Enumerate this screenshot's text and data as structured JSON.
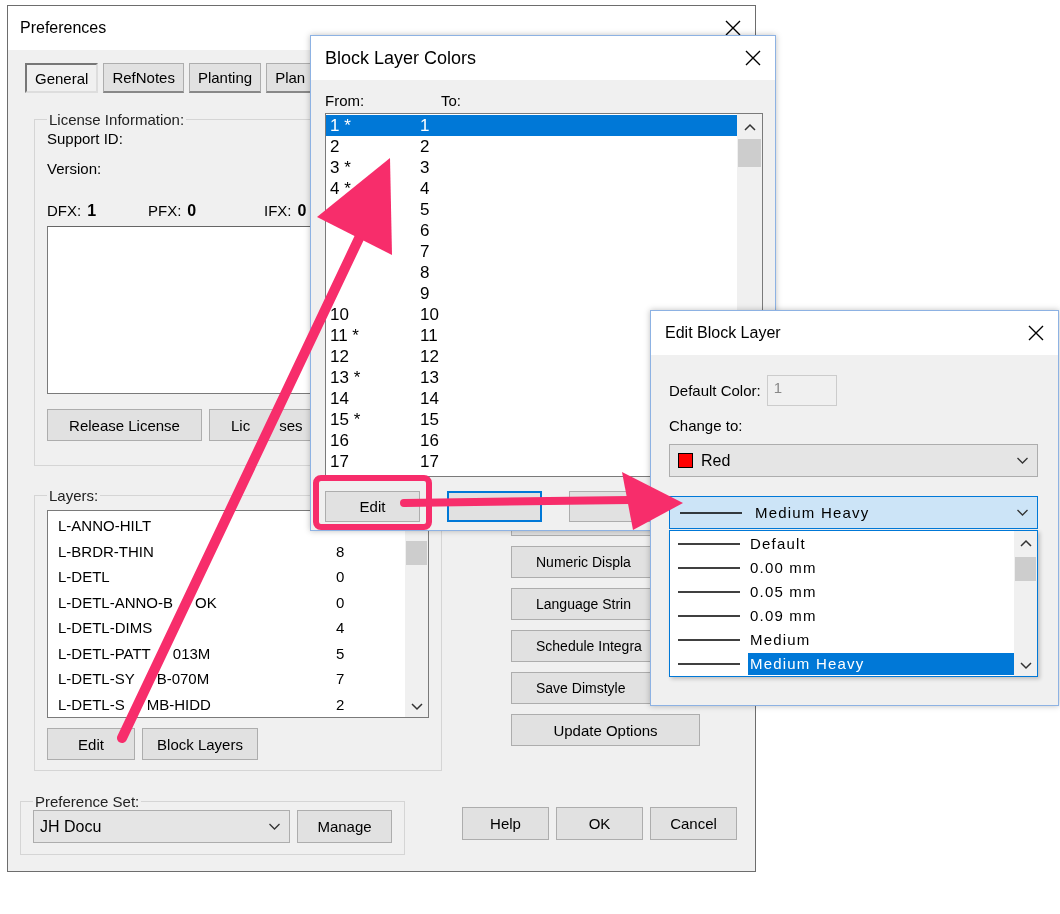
{
  "preferences": {
    "title": "Preferences",
    "tabs": [
      {
        "label": "General",
        "selected": true
      },
      {
        "label": "RefNotes",
        "selected": false
      },
      {
        "label": "Planting",
        "selected": false
      },
      {
        "label": "Plan",
        "selected": false
      }
    ],
    "license": {
      "legend": "License Information:",
      "support_id_label": "Support ID:",
      "version_label": "Version:",
      "counters": [
        {
          "label": "DFX:",
          "value": "1"
        },
        {
          "label": "PFX:",
          "value": "0"
        },
        {
          "label": "IFX:",
          "value": "0"
        }
      ],
      "buttons": [
        {
          "parts": [
            "Release License"
          ]
        },
        {
          "parts": [
            "Lic",
            "ses"
          ]
        }
      ]
    },
    "layers": {
      "legend": "Layers:",
      "rows": [
        {
          "name_parts": [
            "L-ANNO-HILT"
          ]
        },
        {
          "name_parts": [
            "L-BRDR-THIN"
          ],
          "value": "8"
        },
        {
          "name_parts": [
            "L-DETL"
          ],
          "value": "0"
        },
        {
          "name_parts": [
            "L-DETL-ANNO-B",
            "OK"
          ],
          "value": "0"
        },
        {
          "name_parts": [
            "L-DETL-DIMS"
          ],
          "value": "4"
        },
        {
          "name_parts": [
            "L-DETL-PATT",
            "013M"
          ],
          "value": "5"
        },
        {
          "name_parts": [
            "L-DETL-SY",
            "B-070M"
          ],
          "value": "7"
        },
        {
          "name_parts": [
            "L-DETL-S",
            "MB-HIDD"
          ],
          "value": "2"
        }
      ],
      "buttons": [
        "Edit",
        "Block Layers"
      ]
    },
    "side_buttons": [
      "Numeric Displa",
      "Language Strin",
      "Schedule Integra",
      "Save Dimstyle",
      "Update Options"
    ],
    "preference_set": {
      "legend": "Preference Set:",
      "value": "JH Docu",
      "button": "Manage"
    },
    "buttons": [
      "Help",
      "OK",
      "Cancel"
    ]
  },
  "block_layer_colors": {
    "title": "Block Layer Colors",
    "from_label": "From:",
    "to_label": "To:",
    "rows": [
      {
        "from": "1 *",
        "to": "1",
        "selected": true
      },
      {
        "from": "2",
        "to": "2",
        "selected": false
      },
      {
        "from": "3 *",
        "to": "3",
        "selected": false
      },
      {
        "from": "4 *",
        "to": "4",
        "selected": false
      },
      {
        "to": "5",
        "selected": false
      },
      {
        "to": "6",
        "selected": false
      },
      {
        "to": "7",
        "selected": false
      },
      {
        "to": "8",
        "selected": false
      },
      {
        "to": "9",
        "selected": false
      },
      {
        "from": "10",
        "to": "10",
        "selected": false
      },
      {
        "from": "11 *",
        "to": "11",
        "selected": false
      },
      {
        "from": "12",
        "to": "12",
        "selected": false
      },
      {
        "from": "13 *",
        "to": "13",
        "selected": false
      },
      {
        "from": "14",
        "to": "14",
        "selected": false
      },
      {
        "from": "15 *",
        "to": "15",
        "selected": false
      },
      {
        "from": "16",
        "to": "16",
        "selected": false
      },
      {
        "from": "17",
        "to": "17",
        "selected": false
      }
    ],
    "buttons": [
      "Edit"
    ]
  },
  "edit_block_layer": {
    "title": "Edit Block Layer",
    "default_color_label": "Default Color:",
    "default_color_value": "1",
    "change_to_label": "Change to:",
    "color_choice": {
      "label": "Red",
      "color": "#ff0000"
    },
    "lineweight": {
      "value": "Medium Heavy",
      "options": [
        {
          "label": "Default",
          "selected": false
        },
        {
          "label": "0.00 mm",
          "selected": false
        },
        {
          "label": "0.05 mm",
          "selected": false
        },
        {
          "label": "0.09 mm",
          "selected": false
        },
        {
          "label": "Medium",
          "selected": false
        },
        {
          "label": "Medium Heavy",
          "selected": true
        }
      ]
    }
  }
}
